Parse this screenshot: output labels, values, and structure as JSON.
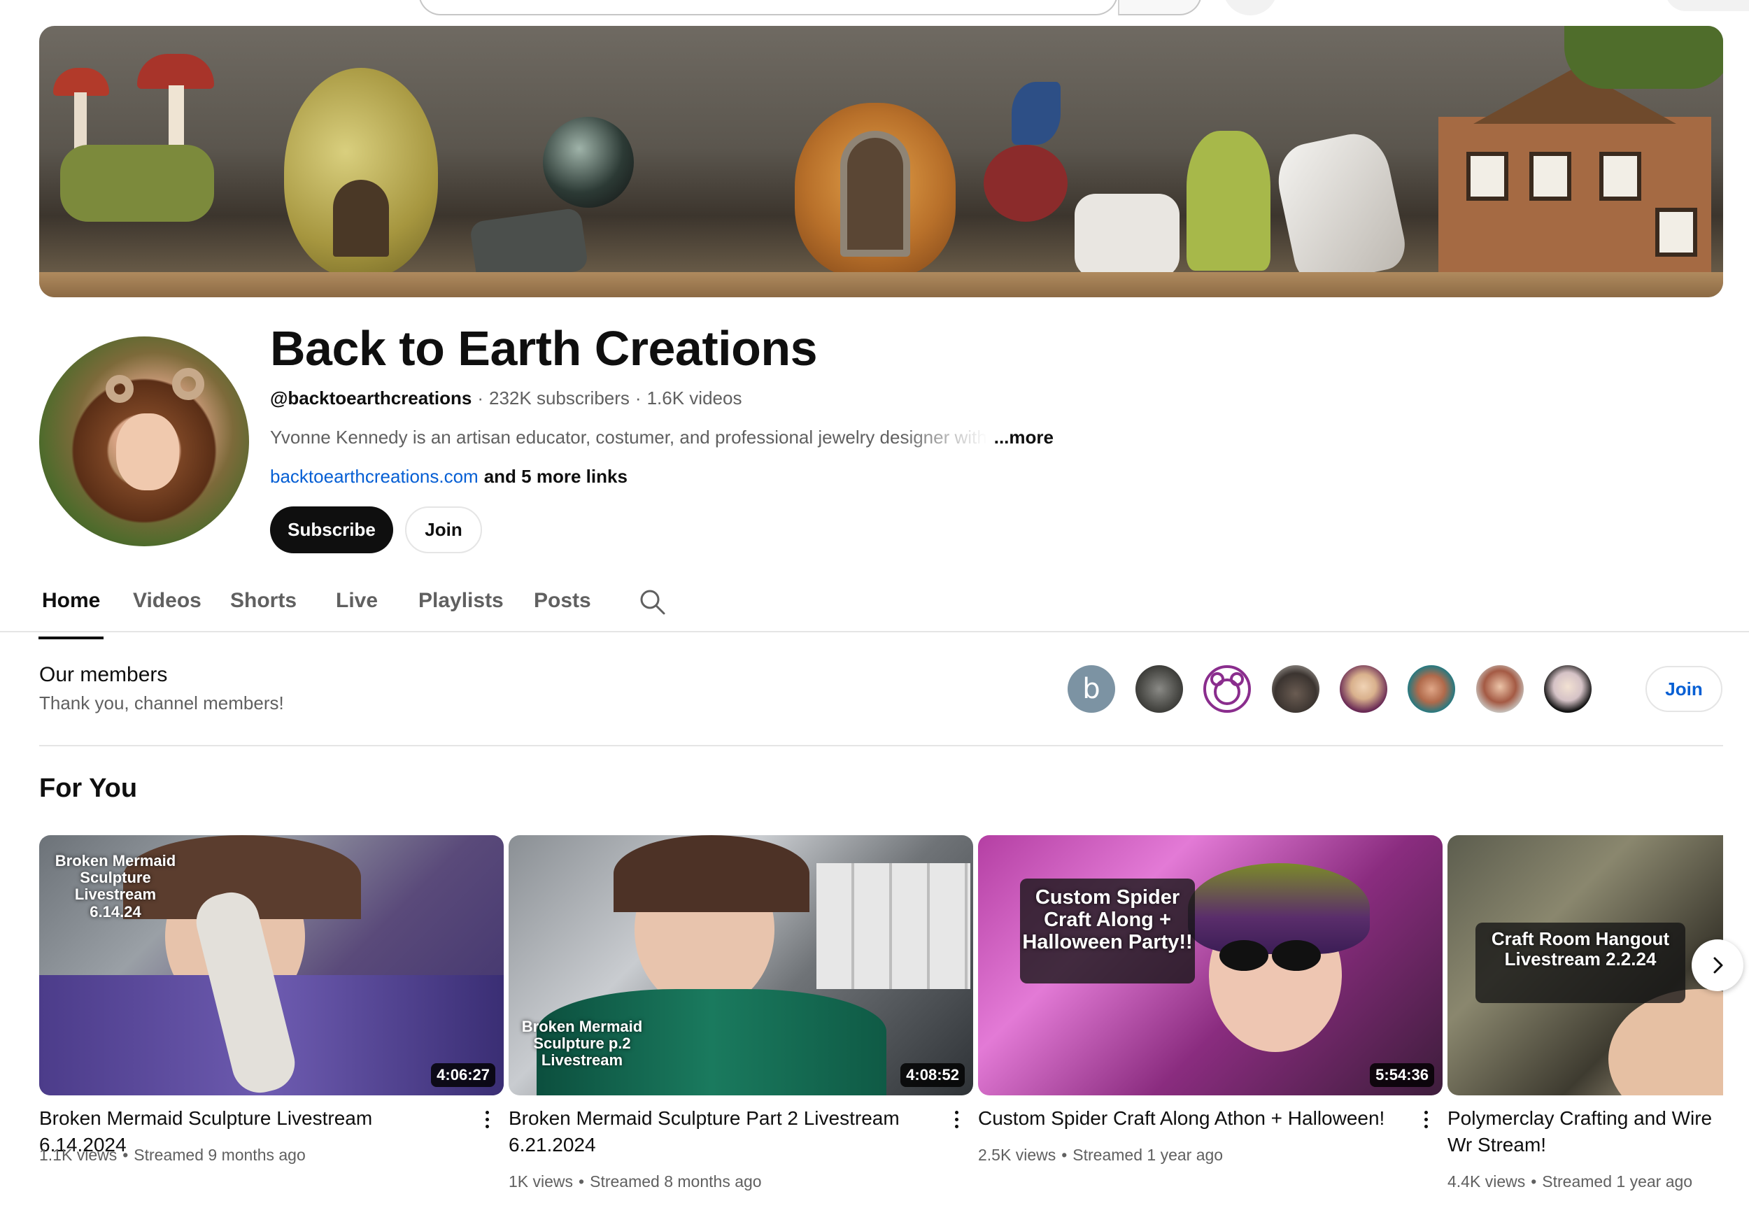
{
  "channel": {
    "name": "Back to Earth Creations",
    "handle": "@backtoearthcreations",
    "subscribers": "232K subscribers",
    "videos_count": "1.6K videos",
    "description": "Yvonne Kennedy is an artisan educator, costumer, and professional jewelry designer with",
    "more_label": "...more",
    "link": "backtoearthcreations.com",
    "more_links": "and 5 more links",
    "subscribe_label": "Subscribe",
    "join_label": "Join"
  },
  "tabs": [
    {
      "label": "Home",
      "active": true
    },
    {
      "label": "Videos"
    },
    {
      "label": "Shorts"
    },
    {
      "label": "Live"
    },
    {
      "label": "Playlists"
    },
    {
      "label": "Posts"
    }
  ],
  "members": {
    "title": "Our members",
    "subtitle": "Thank you, channel members!",
    "first_letter": "b",
    "join_label": "Join"
  },
  "for_you": {
    "title": "For You",
    "videos": [
      {
        "title": "Broken Mermaid Sculpture Livestream 6.14.2024",
        "thumb_text": "Broken Mermaid Sculpture Livestream 6.14.24",
        "duration": "4:06:27",
        "views": "1.1K views",
        "time": "Streamed 9 months ago"
      },
      {
        "title": "Broken Mermaid Sculpture Part 2 Livestream 6.21.2024",
        "thumb_text": "Broken Mermaid Sculpture p.2 Livestream",
        "duration": "4:08:52",
        "views": "1K views",
        "time": "Streamed 8 months ago"
      },
      {
        "title": "Custom Spider Craft Along Athon + Halloween!",
        "thumb_text": "Custom Spider Craft Along + Halloween Party!!",
        "duration": "5:54:36",
        "views": "2.5K views",
        "time": "Streamed 1 year ago"
      },
      {
        "title": "Polymerclay Crafting and Wire Wr Stream!",
        "thumb_text": "Craft Room Hangout Livestream 2.2.24",
        "views": "4.4K views",
        "time": "Streamed 1 year ago"
      }
    ]
  },
  "icons": {
    "tab_search": "search-icon",
    "next": "chevron-right-icon",
    "more_actions": "kebab-menu-icon"
  }
}
